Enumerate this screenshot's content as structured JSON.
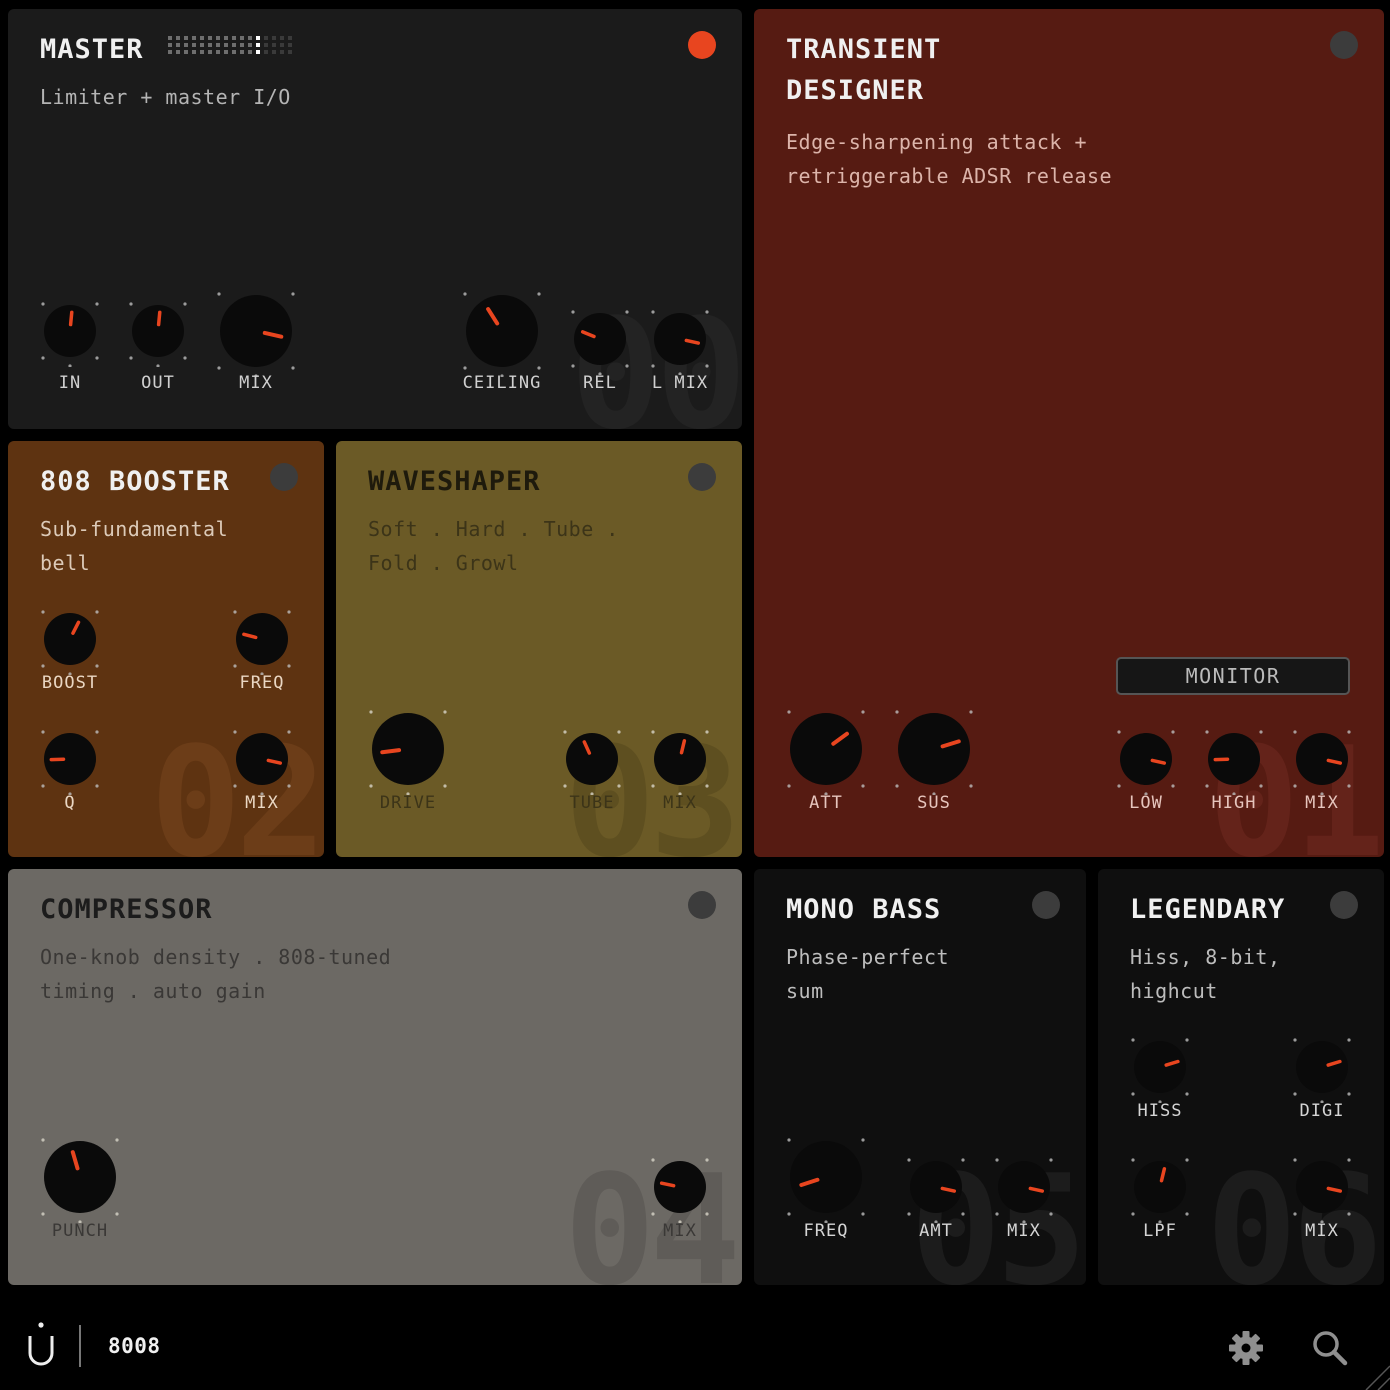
{
  "colors": {
    "accent": "#e8451f",
    "led_active": "#e8451f",
    "led_idle": "#3c3c3c",
    "knob": "#0a0a0a",
    "master_bg": "#1b1b1b",
    "booster_bg": "#5e3311",
    "waveshaper_bg": "#6b5a26",
    "transient_bg": "#561b12",
    "compressor_bg": "#6c6964",
    "monobass_bg": "#0f0f0f",
    "legendary_bg": "#0f0f0f"
  },
  "modules": {
    "master": {
      "title": "MASTER",
      "description": "Limiter + master I/O",
      "number": "00",
      "active": true,
      "meter_level": 0.75,
      "knobs": [
        {
          "label": "IN",
          "value": 0.52
        },
        {
          "label": "OUT",
          "value": 0.52
        },
        {
          "label": "MIX",
          "value": 0.88
        },
        {
          "label": "CEILING",
          "value": 0.38
        },
        {
          "label": "REL",
          "value": 0.25
        },
        {
          "label": "L MIX",
          "value": 0.88
        }
      ]
    },
    "booster": {
      "title": "808 BOOSTER",
      "description": "Sub-fundamental\nbell",
      "number": "02",
      "active": false,
      "knobs": [
        {
          "label": "BOOST",
          "value": 0.6
        },
        {
          "label": "FREQ",
          "value": 0.22
        },
        {
          "label": "Q",
          "value": 0.16
        },
        {
          "label": "MIX",
          "value": 0.88
        }
      ]
    },
    "waveshaper": {
      "title": "WAVESHAPER",
      "description": "Soft . Hard . Tube .\nFold . Growl",
      "number": "03",
      "active": false,
      "knobs": [
        {
          "label": "DRIVE",
          "value": 0.14
        },
        {
          "label": "TUBE",
          "value": 0.41
        },
        {
          "label": "MIX",
          "value": 0.55
        }
      ]
    },
    "transient": {
      "title": "TRANSIENT\nDESIGNER",
      "description": "Edge-sharpening attack +\nretriggerable ADSR release",
      "number": "01",
      "active": false,
      "monitor_label": "MONITOR",
      "knobs": [
        {
          "label": "ATT",
          "value": 0.7
        },
        {
          "label": "SUS",
          "value": 0.77
        },
        {
          "label": "LOW",
          "value": 0.88
        },
        {
          "label": "HIGH",
          "value": 0.16
        },
        {
          "label": "MIX",
          "value": 0.88
        }
      ]
    },
    "compressor": {
      "title": "COMPRESSOR",
      "description": "One-knob density . 808-tuned\ntiming . auto gain",
      "number": "04",
      "active": false,
      "knobs": [
        {
          "label": "PUNCH",
          "value": 0.44
        },
        {
          "label": "MIX",
          "value": 0.21
        }
      ]
    },
    "monobass": {
      "title": "MONO BASS",
      "description": "Phase-perfect\nsum",
      "number": "05",
      "active": false,
      "knobs": [
        {
          "label": "FREQ",
          "value": 0.1
        },
        {
          "label": "AMT",
          "value": 0.88
        },
        {
          "label": "MIX",
          "value": 0.88
        }
      ]
    },
    "legendary": {
      "title": "LEGENDARY",
      "description": "Hiss, 8-bit,\nhighcut",
      "number": "06",
      "active": false,
      "knobs": [
        {
          "label": "HISS",
          "value": 0.77
        },
        {
          "label": "DIGI",
          "value": 0.77
        },
        {
          "label": "LPF",
          "value": 0.55
        },
        {
          "label": "MIX",
          "value": 0.88
        }
      ]
    }
  },
  "footer": {
    "preset_name": "8008",
    "logo_icon": "brand-u-icon",
    "settings_icon": "gear-icon",
    "search_icon": "search-icon",
    "resize_icon": "resize-grip-icon"
  }
}
